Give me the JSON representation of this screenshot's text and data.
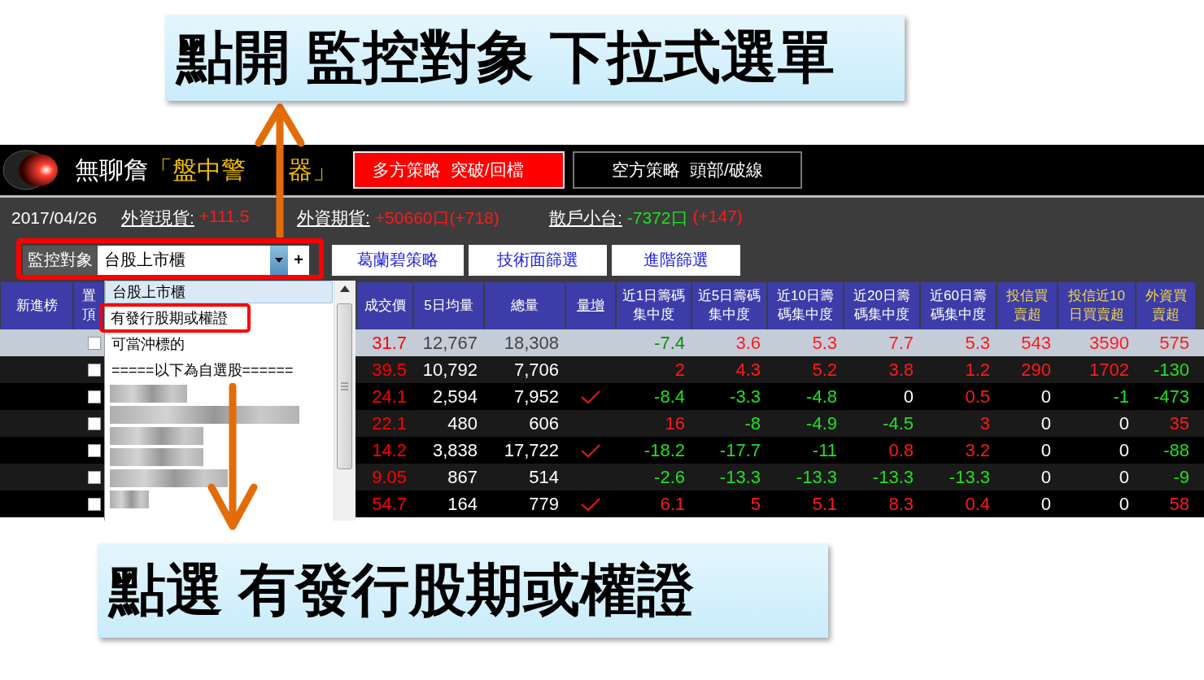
{
  "top_callout": {
    "text": "點開 監控對象 下拉式選單"
  },
  "app": {
    "brand": "無聊詹",
    "title_parts": [
      "「盤中警",
      "器」"
    ],
    "strategy_tabs": [
      {
        "label": "多方策略  突破/回檔",
        "selected": true
      },
      {
        "label": "空方策略  頭部/破線",
        "selected": false
      }
    ],
    "date": "2017/04/26",
    "indicators": [
      {
        "label": "外資現貨:",
        "values": [
          {
            "text": "+111.5",
            "color": "#ff1a1a"
          }
        ]
      },
      {
        "label": "外資期貨:",
        "values": [
          {
            "text": "+50660口(+718)",
            "color": "#ff1a1a"
          }
        ]
      },
      {
        "label": "散戶小台:",
        "values": [
          {
            "text": "-7372口",
            "color": "#22e022"
          },
          {
            "text": "(+147)",
            "color": "#ff1a1a"
          }
        ]
      }
    ],
    "monitor": {
      "label": "監控對象",
      "value": "台股上市櫃",
      "add": "+",
      "expanded": true,
      "options": [
        {
          "label": "台股上市櫃",
          "selected": true,
          "highlighted": false
        },
        {
          "label": "有發行股期或權證",
          "selected": false,
          "highlighted": true
        },
        {
          "label": "可當沖標的",
          "selected": false,
          "highlighted": false
        },
        {
          "label": "=====以下為自選股======",
          "selected": false,
          "highlighted": false
        }
      ]
    },
    "filter_buttons": [
      "葛蘭碧策略",
      "技術面篩選",
      "進階篩選"
    ],
    "table": {
      "columns": [
        {
          "label": "新進榜",
          "kind": "plain"
        },
        {
          "label": "置頂",
          "kind": "plain"
        },
        {
          "label": "成交價",
          "kind": "plain"
        },
        {
          "label": "5日均量",
          "kind": "plain"
        },
        {
          "label": "總量",
          "kind": "plain"
        },
        {
          "label": "量增",
          "kind": "link"
        },
        {
          "label": "近1日籌碼集中度",
          "kind": "plain"
        },
        {
          "label": "近5日籌碼集中度",
          "kind": "plain"
        },
        {
          "label": "近10日籌碼集中度",
          "kind": "plain"
        },
        {
          "label": "近20日籌碼集中度",
          "kind": "plain"
        },
        {
          "label": "近60日籌碼集中度",
          "kind": "plain"
        },
        {
          "label": "投信買賣超",
          "kind": "accent"
        },
        {
          "label": "投信近10日買賣超",
          "kind": "accent"
        },
        {
          "label": "外資買賣超",
          "kind": "accent"
        }
      ],
      "rows": [
        {
          "selected": true,
          "pinned": false,
          "price": {
            "text": "31.7",
            "color": "#ff0000"
          },
          "avg5": "12,767",
          "volume": "18,308",
          "volume_up": false,
          "values": [
            {
              "text": "-7.4",
              "color": "#0c8c0c"
            },
            {
              "text": "3.6",
              "color": "#ff1a1a"
            },
            {
              "text": "5.3",
              "color": "#ff1a1a"
            },
            {
              "text": "7.7",
              "color": "#ff1a1a"
            },
            {
              "text": "5.3",
              "color": "#ff1a1a"
            },
            {
              "text": "543",
              "color": "#ff1a1a"
            },
            {
              "text": "3590",
              "color": "#ff1a1a"
            },
            {
              "text": "575",
              "color": "#ff1a1a"
            }
          ]
        },
        {
          "selected": false,
          "pinned": false,
          "price": {
            "text": "39.5",
            "color": "#ff0000"
          },
          "avg5": "10,792",
          "volume": "7,706",
          "volume_up": false,
          "values": [
            {
              "text": "2",
              "color": "#ff1a1a"
            },
            {
              "text": "4.3",
              "color": "#ff1a1a"
            },
            {
              "text": "5.2",
              "color": "#ff1a1a"
            },
            {
              "text": "3.8",
              "color": "#ff1a1a"
            },
            {
              "text": "1.2",
              "color": "#ff1a1a"
            },
            {
              "text": "290",
              "color": "#ff1a1a"
            },
            {
              "text": "1702",
              "color": "#ff1a1a"
            },
            {
              "text": "-130",
              "color": "#22e022"
            }
          ]
        },
        {
          "selected": false,
          "pinned": false,
          "price": {
            "text": "24.1",
            "color": "#ff0000"
          },
          "avg5": "2,594",
          "volume": "7,952",
          "volume_up": true,
          "values": [
            {
              "text": "-8.4",
              "color": "#22e022"
            },
            {
              "text": "-3.3",
              "color": "#22e022"
            },
            {
              "text": "-4.8",
              "color": "#22e022"
            },
            {
              "text": "0",
              "color": "#ffffff"
            },
            {
              "text": "0.5",
              "color": "#ff1a1a"
            },
            {
              "text": "0",
              "color": "#ffffff"
            },
            {
              "text": "-1",
              "color": "#22e022"
            },
            {
              "text": "-473",
              "color": "#22e022"
            }
          ]
        },
        {
          "selected": false,
          "pinned": false,
          "price": {
            "text": "22.1",
            "color": "#ff0000"
          },
          "avg5": "480",
          "volume": "606",
          "volume_up": false,
          "values": [
            {
              "text": "16",
              "color": "#ff1a1a"
            },
            {
              "text": "-8",
              "color": "#22e022"
            },
            {
              "text": "-4.9",
              "color": "#22e022"
            },
            {
              "text": "-4.5",
              "color": "#22e022"
            },
            {
              "text": "3",
              "color": "#ff1a1a"
            },
            {
              "text": "0",
              "color": "#ffffff"
            },
            {
              "text": "0",
              "color": "#ffffff"
            },
            {
              "text": "35",
              "color": "#ff1a1a"
            }
          ]
        },
        {
          "selected": false,
          "pinned": false,
          "price": {
            "text": "14.2",
            "color": "#ff0000"
          },
          "avg5": "3,838",
          "volume": "17,722",
          "volume_up": true,
          "values": [
            {
              "text": "-18.2",
              "color": "#22e022"
            },
            {
              "text": "-17.7",
              "color": "#22e022"
            },
            {
              "text": "-11",
              "color": "#22e022"
            },
            {
              "text": "0.8",
              "color": "#ff1a1a"
            },
            {
              "text": "3.2",
              "color": "#ff1a1a"
            },
            {
              "text": "0",
              "color": "#ffffff"
            },
            {
              "text": "0",
              "color": "#ffffff"
            },
            {
              "text": "-88",
              "color": "#22e022"
            }
          ]
        },
        {
          "selected": false,
          "pinned": false,
          "price": {
            "text": "9.05",
            "color": "#ff0000"
          },
          "avg5": "867",
          "volume": "514",
          "volume_up": false,
          "values": [
            {
              "text": "-2.6",
              "color": "#22e022"
            },
            {
              "text": "-13.3",
              "color": "#22e022"
            },
            {
              "text": "-13.3",
              "color": "#22e022"
            },
            {
              "text": "-13.3",
              "color": "#22e022"
            },
            {
              "text": "-13.3",
              "color": "#22e022"
            },
            {
              "text": "0",
              "color": "#ffffff"
            },
            {
              "text": "0",
              "color": "#ffffff"
            },
            {
              "text": "-9",
              "color": "#22e022"
            }
          ]
        },
        {
          "selected": false,
          "pinned": false,
          "price": {
            "text": "54.7",
            "color": "#ff0000"
          },
          "avg5": "164",
          "volume": "779",
          "volume_up": true,
          "values": [
            {
              "text": "6.1",
              "color": "#ff1a1a"
            },
            {
              "text": "5",
              "color": "#ff1a1a"
            },
            {
              "text": "5.1",
              "color": "#ff1a1a"
            },
            {
              "text": "8.3",
              "color": "#ff1a1a"
            },
            {
              "text": "0.4",
              "color": "#ff1a1a"
            },
            {
              "text": "0",
              "color": "#ffffff"
            },
            {
              "text": "0",
              "color": "#ffffff"
            },
            {
              "text": "58",
              "color": "#ff1a1a"
            }
          ]
        }
      ]
    }
  },
  "bottom_callout": {
    "text": "點選 有發行股期或權證"
  }
}
